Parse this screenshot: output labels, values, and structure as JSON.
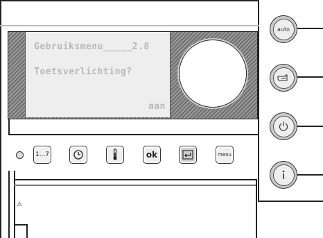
{
  "display": {
    "menu_title": "Gebruiksmenu",
    "menu_dots": "_____",
    "menu_number": "2.8",
    "question": "Toetsverlichting?",
    "value": "aan"
  },
  "keys": [
    {
      "id": "program",
      "label": "1...7",
      "icon": "program-days-icon"
    },
    {
      "id": "clock",
      "label": "",
      "icon": "clock-icon"
    },
    {
      "id": "temperature",
      "label": "",
      "icon": "thermometer-icon"
    },
    {
      "id": "ok",
      "label": "ok",
      "icon": "ok-icon"
    },
    {
      "id": "back",
      "label": "",
      "icon": "return-arrow-icon"
    },
    {
      "id": "menu",
      "label": "menu",
      "icon": "menu-icon"
    }
  ],
  "side_buttons": [
    {
      "id": "auto",
      "label": "auto",
      "icon": "auto-mode-icon"
    },
    {
      "id": "manual",
      "label": "",
      "icon": "hand-icon"
    },
    {
      "id": "power",
      "label": "",
      "icon": "power-icon"
    },
    {
      "id": "info",
      "label": "",
      "icon": "info-icon"
    }
  ],
  "warning_symbol": "⚠"
}
